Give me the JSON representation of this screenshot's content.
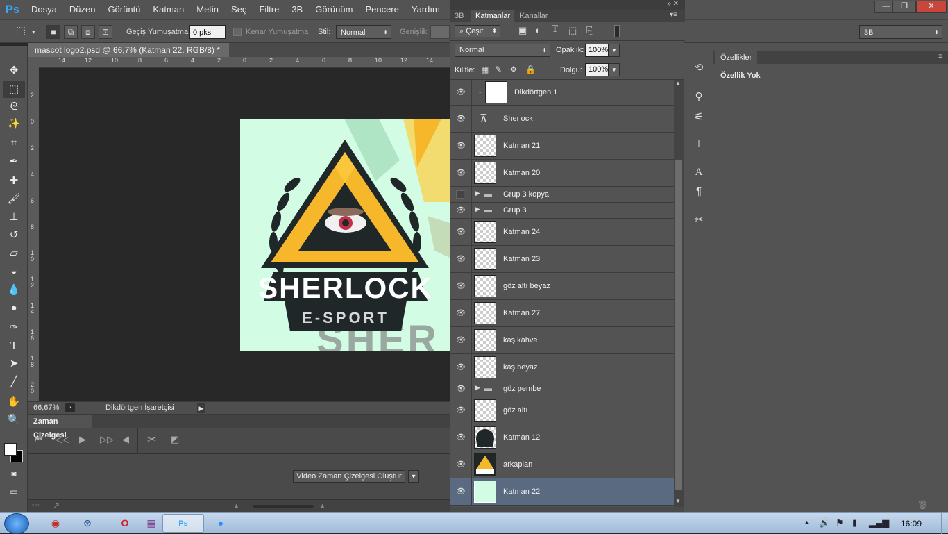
{
  "app": {
    "logo": "Ps"
  },
  "menu": [
    "Dosya",
    "Düzen",
    "Görüntü",
    "Katman",
    "Metin",
    "Seç",
    "Filtre",
    "3B",
    "Görünüm",
    "Pencere",
    "Yardım"
  ],
  "window_controls": {
    "minimize": "—",
    "restore": "❐",
    "close": "✕"
  },
  "options": {
    "feather_label": "Geçiş Yumuşatma:",
    "feather_value": "0 pks",
    "antialias_label": "Kenar Yumuşatma",
    "style_label": "Stil:",
    "style_value": "Normal",
    "width_label": "Genişlik:",
    "workspace_value": "3B"
  },
  "document": {
    "tab_title": "mascot logo2.psd @ 66,7% (Katman 22, RGB/8) *",
    "zoom": "66,67%",
    "status_tool": "Dikdörtgen İşaretçisi",
    "ruler_top": [
      "14",
      "12",
      "10",
      "8",
      "6",
      "4",
      "2",
      "0",
      "2",
      "4",
      "6",
      "8",
      "10",
      "12",
      "14"
    ],
    "ruler_left": [
      "2",
      "0",
      "2",
      "4",
      "6",
      "8",
      "1 0",
      "1 2",
      "1 4",
      "1 6",
      "1 8",
      "2 0"
    ]
  },
  "logo": {
    "title": "SHERLOCK",
    "subtitle": "E-SPORT",
    "bg_text": "SHER"
  },
  "timeline": {
    "title": "Zaman Çizelgesi",
    "create_button": "Video Zaman Çizelgesi Oluştur"
  },
  "layers_panel": {
    "tabs": [
      "3B",
      "Katmanlar",
      "Kanallar"
    ],
    "filter_label": "Çeşit",
    "blend_mode": "Normal",
    "opacity_label": "Opaklık:",
    "opacity_value": "100%",
    "lock_label": "Kilitle:",
    "fill_label": "Dolgu:",
    "fill_value": "100%",
    "layers": [
      {
        "name": "Dikdörtgen 1",
        "type": "shape",
        "visible": true,
        "clipped": true
      },
      {
        "name": "Sherlock",
        "type": "text",
        "visible": true
      },
      {
        "name": "Katman 21",
        "type": "pixel",
        "visible": true
      },
      {
        "name": "Katman 20",
        "type": "pixel",
        "visible": true
      },
      {
        "name": "Grup 3 kopya",
        "type": "group",
        "visible": false
      },
      {
        "name": "Grup 3",
        "type": "group",
        "visible": true
      },
      {
        "name": "Katman 24",
        "type": "pixel",
        "visible": true
      },
      {
        "name": "Katman 23",
        "type": "pixel",
        "visible": true
      },
      {
        "name": "göz altı beyaz",
        "type": "pixel",
        "visible": true
      },
      {
        "name": "Katman 27",
        "type": "pixel",
        "visible": true
      },
      {
        "name": "kaş kahve",
        "type": "pixel",
        "visible": true
      },
      {
        "name": "kaş beyaz",
        "type": "pixel",
        "visible": true
      },
      {
        "name": "göz pembe",
        "type": "group",
        "visible": true
      },
      {
        "name": "göz altı",
        "type": "pixel",
        "visible": true
      },
      {
        "name": "Katman 12",
        "type": "pixel-dark",
        "visible": true
      },
      {
        "name": "arkaplan",
        "type": "pixel-art",
        "visible": true
      },
      {
        "name": "Katman 22",
        "type": "pixel-mint",
        "visible": true,
        "selected": true
      }
    ]
  },
  "properties": {
    "tab": "Özellikler",
    "empty": "Özellik Yok"
  },
  "taskbar": {
    "clock": "16:09"
  },
  "colors": {
    "panel": "#535353",
    "canvas_bg": "#d2fde4",
    "logo_yellow": "#f6b82a",
    "logo_dark": "#1f2728"
  }
}
